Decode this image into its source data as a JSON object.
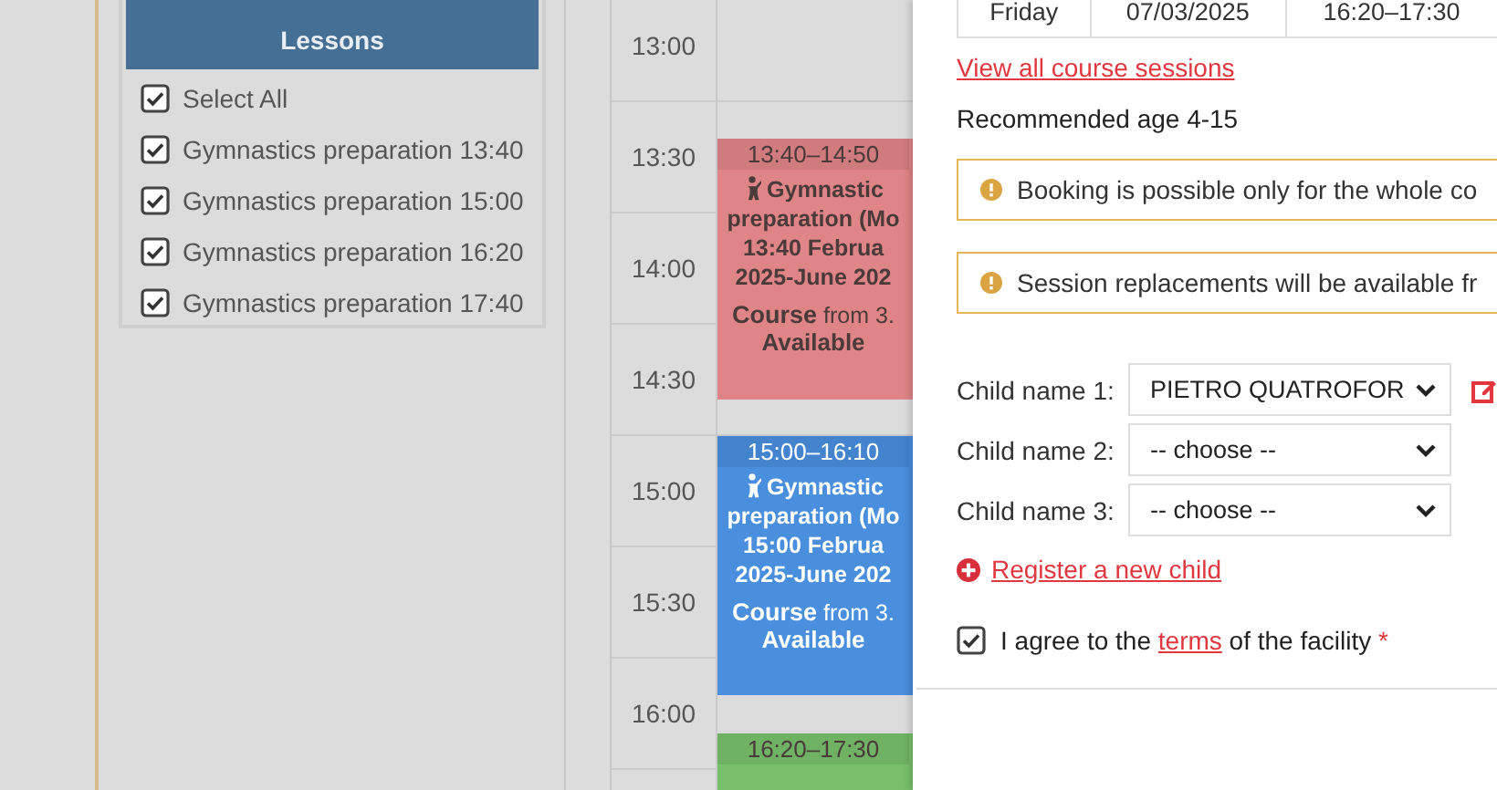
{
  "filter_panel": {
    "title": "Lessons",
    "items": [
      {
        "label": "Select All",
        "checked": true
      },
      {
        "label": "Gymnastics preparation 13:40",
        "checked": true
      },
      {
        "label": "Gymnastics preparation 15:00",
        "checked": true
      },
      {
        "label": "Gymnastics preparation 16:20",
        "checked": true
      },
      {
        "label": "Gymnastics preparation 17:40",
        "checked": true
      }
    ]
  },
  "calendar": {
    "times": [
      "13:00",
      "13:30",
      "14:00",
      "14:30",
      "15:00",
      "15:30",
      "16:00"
    ],
    "events": [
      {
        "time": "13:40–14:50",
        "color": "#e08587",
        "title_lines": [
          "Gymnastic",
          "preparation (Mo",
          "13:40 Februa",
          "2025-June 202"
        ],
        "price": "**Course** from 3.",
        "status": "Available"
      },
      {
        "time": "15:00–16:10",
        "color": "#4a8fde",
        "title_lines": [
          "Gymnastic",
          "preparation (Mo",
          "15:00 Februa",
          "2025-June 202"
        ],
        "price": "**Course** from 3.",
        "status": "Available"
      },
      {
        "time": "16:20–17:30",
        "color": "#78c06c"
      }
    ]
  },
  "details": {
    "session_row": [
      "Friday",
      "07/03/2025",
      "16:20–17:30"
    ],
    "sessions_link": "View all course sessions",
    "age": "Recommended age 4-15",
    "notices": [
      "Booking is possible only for the whole co",
      "Session replacements will be available fr"
    ],
    "children": [
      {
        "label": "Child name 1:",
        "value": "PIETRO QUATROFOR",
        "editable": true
      },
      {
        "label": "Child name 2:",
        "value": "-- choose --",
        "editable": false
      },
      {
        "label": "Child name 3:",
        "value": "-- choose --",
        "editable": false
      }
    ],
    "register_link": "Register a new child",
    "agreement": {
      "checked": true,
      "before": "I agree to the ",
      "link": "terms",
      "after": " of the facility",
      "required_mark": "*"
    }
  }
}
